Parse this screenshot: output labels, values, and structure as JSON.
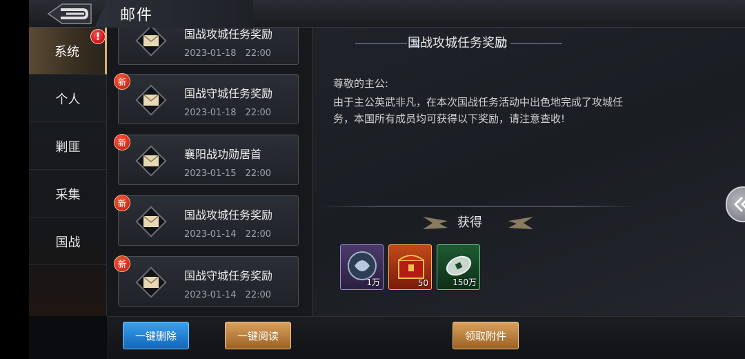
{
  "header": {
    "title": "邮件",
    "back_icon": "back-arrow-icon"
  },
  "sidebar": {
    "alert": "!",
    "items": [
      {
        "label": "系统",
        "active": true
      },
      {
        "label": "个人"
      },
      {
        "label": "剿匪"
      },
      {
        "label": "采集"
      },
      {
        "label": "国战"
      }
    ]
  },
  "mail_list": [
    {
      "title": "国战攻城任务奖励",
      "date": "2023-01-18　22:00"
    },
    {
      "title": "国战守城任务奖励",
      "date": "2023-01-18　22:00",
      "badge": "新"
    },
    {
      "title": "襄阳战功勋居首",
      "date": "2023-01-15　22:00",
      "badge": "新"
    },
    {
      "title": "国战攻城任务奖励",
      "date": "2023-01-14　22:00",
      "badge": "新"
    },
    {
      "title": "国战守城任务奖励",
      "date": "2023-01-14　22:00",
      "badge": "新"
    }
  ],
  "detail": {
    "title": "国战攻城任务奖励",
    "greeting": "尊敬的主公:",
    "body": "由于主公英武非凡，在本次国战任务活动中出色地完成了攻城任务，本国所有成员均可获得以下奖励，请注意查收!",
    "reward_header": "获得",
    "rewards": [
      {
        "icon": "jade-token-icon",
        "qty": "1万"
      },
      {
        "icon": "treasure-chest-icon",
        "qty": "50"
      },
      {
        "icon": "copper-coin-icon",
        "qty": "150万"
      }
    ]
  },
  "buttons": {
    "delete_all": "一键删除",
    "read_all": "一键阅读",
    "claim": "领取附件"
  },
  "colors": {
    "accent_gold": "#d8b073",
    "button_blue": "#1f7fd6",
    "button_gold": "#b87a3a",
    "badge_red": "#d31e10"
  }
}
